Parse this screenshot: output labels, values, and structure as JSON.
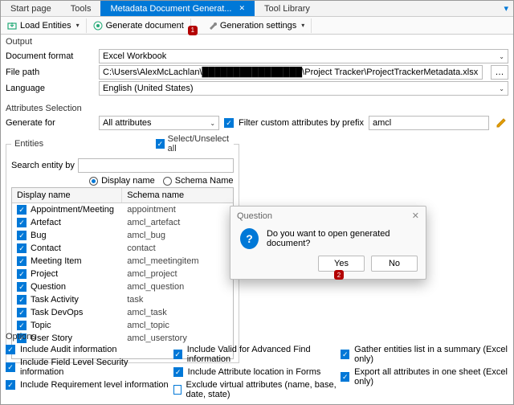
{
  "tabs": {
    "start": "Start page",
    "tools": "Tools",
    "active": "Metadata Document Generat...",
    "library": "Tool Library"
  },
  "toolbar": {
    "load": "Load Entities",
    "generate": "Generate document",
    "settings": "Generation settings",
    "badge1": "1"
  },
  "output": {
    "title": "Output",
    "format_label": "Document format",
    "format_value": "Excel Workbook",
    "filepath_label": "File path",
    "filepath_value": "C:\\Users\\AlexMcLachlan\\████████████████\\Project Tracker\\ProjectTrackerMetadata.xlsx",
    "language_label": "Language",
    "language_value": "English (United States)"
  },
  "attrs": {
    "title": "Attributes Selection",
    "genfor_label": "Generate for",
    "genfor_value": "All attributes",
    "filter_label": "Filter custom attributes by prefix",
    "filter_value": "amcl"
  },
  "entities": {
    "title": "Entities",
    "selectall": "Select/Unselect all",
    "search_label": "Search entity by",
    "search_placeholder": "",
    "radio_display": "Display name",
    "radio_schema": "Schema Name",
    "col_display": "Display name",
    "col_schema": "Schema name",
    "rows": [
      {
        "d": "Appointment/Meeting",
        "s": "appointment"
      },
      {
        "d": "Artefact",
        "s": "amcl_artefact"
      },
      {
        "d": "Bug",
        "s": "amcl_bug"
      },
      {
        "d": "Contact",
        "s": "contact"
      },
      {
        "d": "Meeting Item",
        "s": "amcl_meetingitem"
      },
      {
        "d": "Project",
        "s": "amcl_project"
      },
      {
        "d": "Question",
        "s": "amcl_question"
      },
      {
        "d": "Task Activity",
        "s": "task"
      },
      {
        "d": "Task DevOps",
        "s": "amcl_task"
      },
      {
        "d": "Topic",
        "s": "amcl_topic"
      },
      {
        "d": "User Story",
        "s": "amcl_userstory"
      }
    ]
  },
  "options": {
    "title": "Options",
    "c1a": "Include Audit information",
    "c1b": "Include Field Level Security information",
    "c1c": "Include Requirement level information",
    "c2a": "Include Valid for Advanced Find information",
    "c2b": "Include Attribute location in Forms",
    "c2c": "Exclude virtual attributes (name, base, date, state)",
    "c3a": "Gather entities list in a summary (Excel only)",
    "c3b": "Export all attributes in one sheet (Excel only)"
  },
  "dialog": {
    "title": "Question",
    "msg": "Do you want to open generated document?",
    "yes": "Yes",
    "no": "No",
    "badge2": "2"
  }
}
